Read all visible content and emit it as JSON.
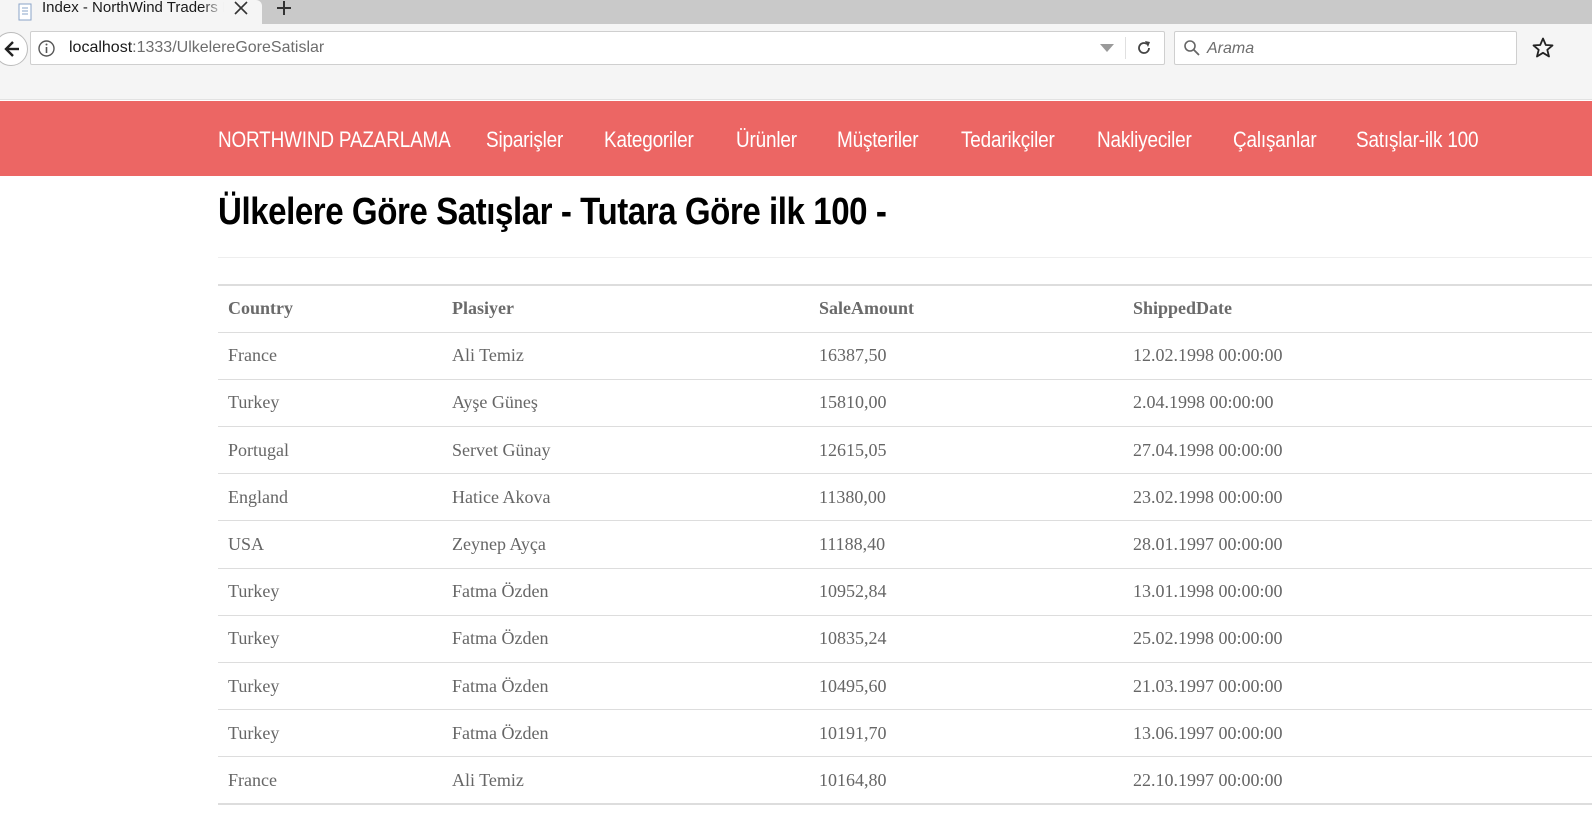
{
  "browser": {
    "tab_title": "Index - NorthWind Traders MVC",
    "url_host": "localhost",
    "url_rest": ":1333/UlkelereGoreSatislar",
    "search_placeholder": "Arama"
  },
  "nav": {
    "brand": "NORTHWIND PAZARLAMA",
    "links": [
      "Siparişler",
      "Kategoriler",
      "Ürünler",
      "Müşteriler",
      "Tedarikçiler",
      "Nakliyeciler",
      "Çalışanlar",
      "Satışlar-ilk 100"
    ],
    "color": "#ec6664"
  },
  "page": {
    "title": "Ülkelere Göre Satışlar - Tutara Göre ilk 100 -"
  },
  "table": {
    "headers": [
      "Country",
      "Plasiyer",
      "SaleAmount",
      "ShippedDate"
    ],
    "rows": [
      [
        "France",
        "Ali Temiz",
        "16387,50",
        "12.02.1998 00:00:00"
      ],
      [
        "Turkey",
        "Ayşe Güneş",
        "15810,00",
        "2.04.1998 00:00:00"
      ],
      [
        "Portugal",
        "Servet Günay",
        "12615,05",
        "27.04.1998 00:00:00"
      ],
      [
        "England",
        "Hatice Akova",
        "11380,00",
        "23.02.1998 00:00:00"
      ],
      [
        "USA",
        "Zeynep Ayça",
        "11188,40",
        "28.01.1997 00:00:00"
      ],
      [
        "Turkey",
        "Fatma Özden",
        "10952,84",
        "13.01.1998 00:00:00"
      ],
      [
        "Turkey",
        "Fatma Özden",
        "10835,24",
        "25.02.1998 00:00:00"
      ],
      [
        "Turkey",
        "Fatma Özden",
        "10495,60",
        "21.03.1997 00:00:00"
      ],
      [
        "Turkey",
        "Fatma Özden",
        "10191,70",
        "13.06.1997 00:00:00"
      ],
      [
        "France",
        "Ali Temiz",
        "10164,80",
        "22.10.1997 00:00:00"
      ]
    ]
  }
}
